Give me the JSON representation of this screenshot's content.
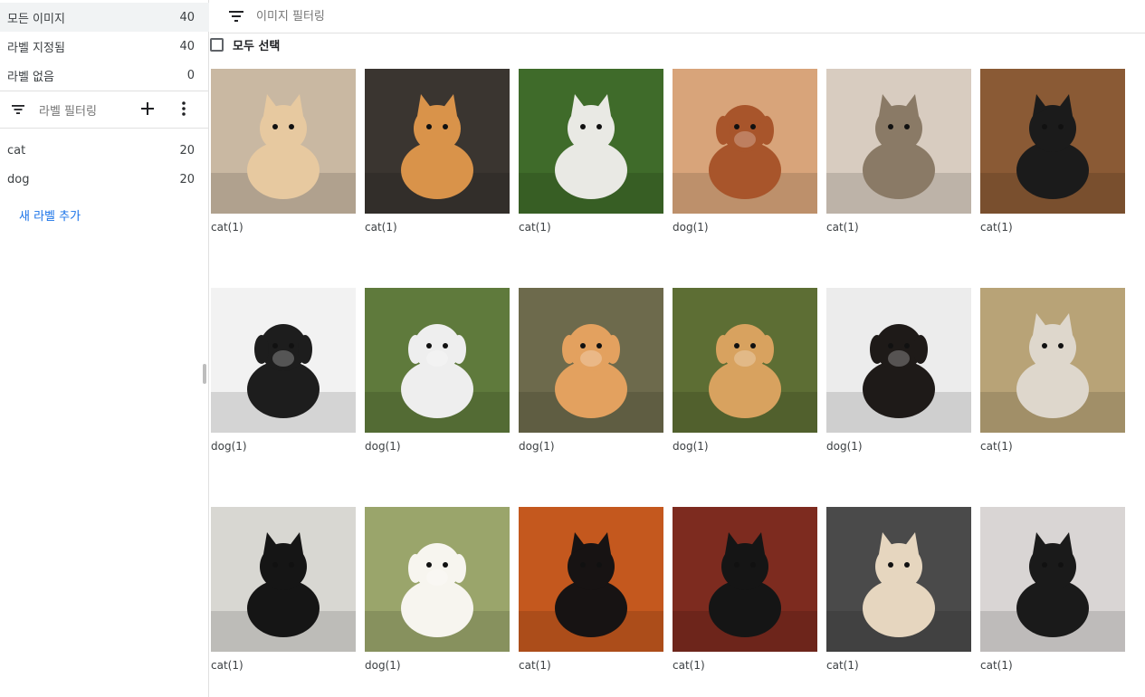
{
  "sidebar": {
    "counts": [
      {
        "label": "모든 이미지",
        "count": "40"
      },
      {
        "label": "라벨 지정됨",
        "count": "40"
      },
      {
        "label": "라벨 없음",
        "count": "0"
      }
    ],
    "label_filter_placeholder": "라벨 필터링",
    "labels": [
      {
        "label": "cat",
        "count": "20"
      },
      {
        "label": "dog",
        "count": "20"
      }
    ],
    "add_label": "새 라벨 추가"
  },
  "topbar": {
    "filter_placeholder": "이미지 필터링"
  },
  "select_all": "모두 선택",
  "colors": {
    "accent": "#1a73e8",
    "active_bg": "#f1f3f4",
    "divider": "#e0e0e0"
  },
  "images": [
    {
      "caption": "cat(1)",
      "subject": "cat",
      "bg": "#c9b8a2",
      "fg": "#e7c9a0"
    },
    {
      "caption": "cat(1)",
      "subject": "cat",
      "bg": "#3a3530",
      "fg": "#d9934a"
    },
    {
      "caption": "cat(1)",
      "subject": "cat",
      "bg": "#3f6b2a",
      "fg": "#e9e9e4"
    },
    {
      "caption": "dog(1)",
      "subject": "dog",
      "bg": "#d8a47a",
      "fg": "#a8552b"
    },
    {
      "caption": "cat(1)",
      "subject": "cat",
      "bg": "#d8ccc0",
      "fg": "#8a7a66"
    },
    {
      "caption": "cat(1)",
      "subject": "cat",
      "bg": "#8a5a35",
      "fg": "#1b1b1b"
    },
    {
      "caption": "dog(1)",
      "subject": "dog",
      "bg": "#f2f2f2",
      "fg": "#1d1d1d"
    },
    {
      "caption": "dog(1)",
      "subject": "dog",
      "bg": "#5f7a3c",
      "fg": "#eeeeee"
    },
    {
      "caption": "dog(1)",
      "subject": "dog",
      "bg": "#6d6a4c",
      "fg": "#e3a15f"
    },
    {
      "caption": "dog(1)",
      "subject": "dog",
      "bg": "#5d6e34",
      "fg": "#d8a25f"
    },
    {
      "caption": "dog(1)",
      "subject": "dog",
      "bg": "#ececec",
      "fg": "#1e1a18"
    },
    {
      "caption": "cat(1)",
      "subject": "cat",
      "bg": "#b8a377",
      "fg": "#ded7cc"
    },
    {
      "caption": "cat(1)",
      "subject": "cat",
      "bg": "#d8d7d2",
      "fg": "#151515"
    },
    {
      "caption": "dog(1)",
      "subject": "dog",
      "bg": "#9aa56b",
      "fg": "#f7f5ef"
    },
    {
      "caption": "cat(1)",
      "subject": "cat",
      "bg": "#c4581e",
      "fg": "#171313"
    },
    {
      "caption": "cat(1)",
      "subject": "cat",
      "bg": "#7d2b1f",
      "fg": "#151515"
    },
    {
      "caption": "cat(1)",
      "subject": "cat",
      "bg": "#4a4a4a",
      "fg": "#e6d6bf"
    },
    {
      "caption": "cat(1)",
      "subject": "cat",
      "bg": "#d9d5d4",
      "fg": "#1a1a1a"
    }
  ]
}
